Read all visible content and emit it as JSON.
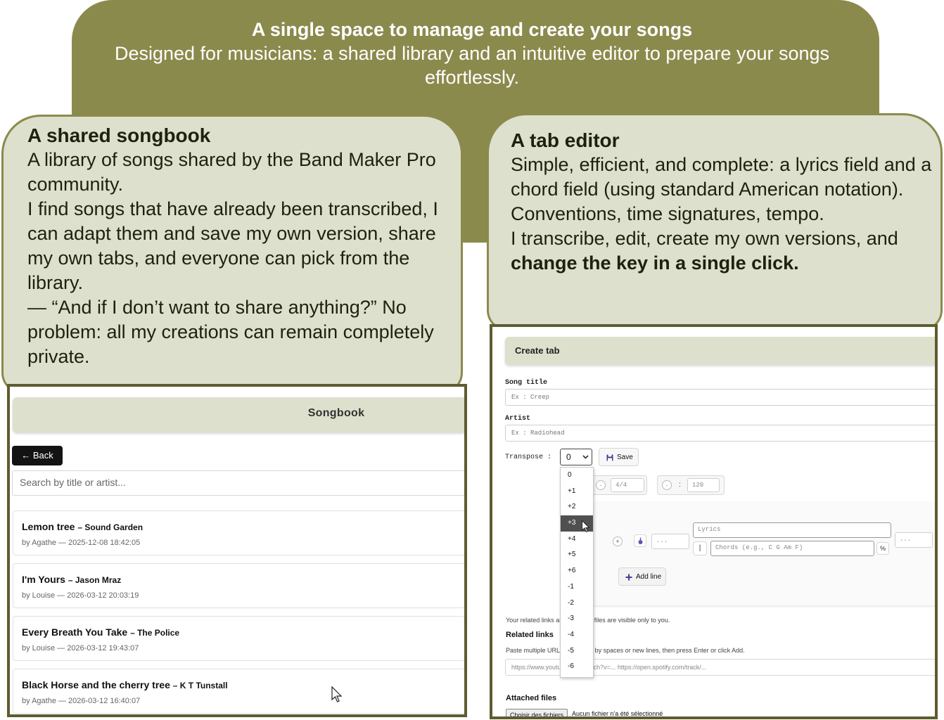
{
  "banner": {
    "title": "A single space to manage and create your songs",
    "subtitle": "Designed for musicians: a shared library and an intuitive editor to prepare your songs effortlessly."
  },
  "songbook_card": {
    "title": "A shared songbook",
    "p1": "A library of songs shared by the Band Maker Pro community.",
    "p2": "I find songs that have already been transcribed, I can adapt them and save my own version, share my own tabs, and everyone can pick from the library.",
    "p3": "— “And if I don’t want to share anything?” No problem: all my creations can remain completely private."
  },
  "editor_card": {
    "title": "A tab editor",
    "p1": "Simple, efficient, and complete: a lyrics field and a chord field (using standard American notation).",
    "p2": "Conventions, time signatures, tempo.",
    "p3_start": "I transcribe, edit, create my own versions, and ",
    "p3_bold": "change the key in a single click."
  },
  "songbook": {
    "header": "Songbook",
    "back_label": "← Back",
    "search_placeholder": "Search by title or artist...",
    "songs": [
      {
        "title": "Lemon tree",
        "artist": "– Sound Garden",
        "meta": "by Agathe — 2025-12-08 18:42:05"
      },
      {
        "title": "I'm Yours",
        "artist": "– Jason Mraz",
        "meta": "by Louise — 2026-03-12 20:03:19"
      },
      {
        "title": "Every Breath You Take",
        "artist": "– The Police",
        "meta": "by Louise — 2026-03-12 19:43:07"
      },
      {
        "title": "Black Horse and the cherry tree",
        "artist": "– K T Tunstall",
        "meta": "by Agathe — 2026-03-12 16:40:07"
      }
    ]
  },
  "tab_editor": {
    "header": "Create tab",
    "song_title_label": "Song title",
    "song_title_placeholder": "Ex : Creep",
    "artist_label": "Artist",
    "artist_placeholder": "Ex : Radiohead",
    "transpose_label": "Transpose :",
    "transpose_value": "0",
    "save_label": "Save",
    "time_signature": "4/4",
    "tempo_sep": ":",
    "tempo": "120",
    "lyrics_placeholder": "Lyrics",
    "chords_placeholder": "Chords (e.g., C G Am F)",
    "chord_prefix": "|",
    "dots": "...",
    "percent_icon": "%",
    "add_line_label": "Add line",
    "related_note": "Your related links and attached files are visible only to you.",
    "related_links_title": "Related links",
    "related_links_help": "Paste multiple URLs separated by spaces or new lines, then press Enter or click Add.",
    "links_placeholder": "https://www.youtube.com/watch?v=...  https://open.spotify.com/track/...",
    "attached_files_title": "Attached files",
    "choose_files": "Choisir des fichiers",
    "no_file": "Aucun fichier n'a été sélectionné",
    "transpose_options": [
      "0",
      "+1",
      "+2",
      "+3",
      "+4",
      "+5",
      "+6",
      "-1",
      "-2",
      "-3",
      "-4",
      "-5",
      "-6"
    ],
    "highlighted_option": "+3"
  },
  "colors": {
    "olive": "#8b8a4d",
    "card_bg": "#dde0cc",
    "frame": "#5e5c30"
  }
}
